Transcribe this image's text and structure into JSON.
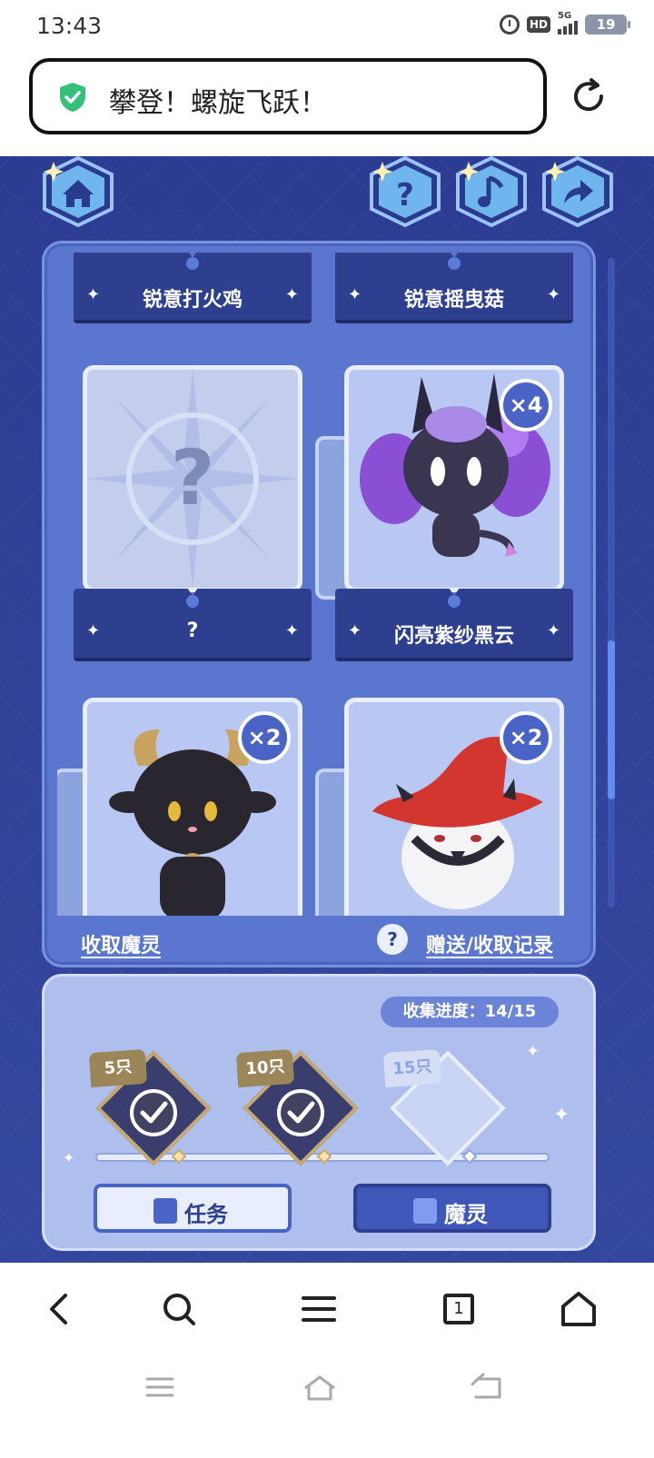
{
  "status_bar": {
    "time": "13:43",
    "network": "5G",
    "hd": "HD",
    "battery": "19"
  },
  "url_bar": {
    "title": "攀登！螺旋飞跃！",
    "secure_icon": "shield-check-icon",
    "reload_icon": "reload-icon"
  },
  "top_buttons": {
    "home": "home-icon",
    "help": "question-icon",
    "music": "music-note-icon",
    "share": "share-arrow-icon",
    "help_glyph": "?"
  },
  "cards": [
    {
      "name": "锐意打火鸡",
      "count": null,
      "locked": false
    },
    {
      "name": "锐意摇曳菇",
      "count": null,
      "locked": false
    },
    {
      "name": "?",
      "count": null,
      "locked": true,
      "glyph": "?"
    },
    {
      "name": "闪亮紫纱黑云",
      "count": "×4",
      "locked": false
    },
    {
      "name": "",
      "count": "×2",
      "locked": false
    },
    {
      "name": "",
      "count": "×2",
      "locked": false
    }
  ],
  "panel_links": {
    "collect": "收取魔灵",
    "records_help": "?",
    "records": "赠送/收取记录"
  },
  "progress": {
    "label": "收集进度：14/15",
    "current": 14,
    "total": 15,
    "milestones": [
      {
        "tag": "5只",
        "done": true
      },
      {
        "tag": "10只",
        "done": true
      },
      {
        "tag": "15只",
        "done": false
      }
    ]
  },
  "buttons": {
    "task": "任务",
    "spirit": "魔灵"
  },
  "browser_nav": {
    "tab_count": "1"
  },
  "colors": {
    "game_bg": "#2f3f95",
    "panel": "#5a76cf",
    "accent": "#4a63c6",
    "gold": "#c6a971"
  }
}
